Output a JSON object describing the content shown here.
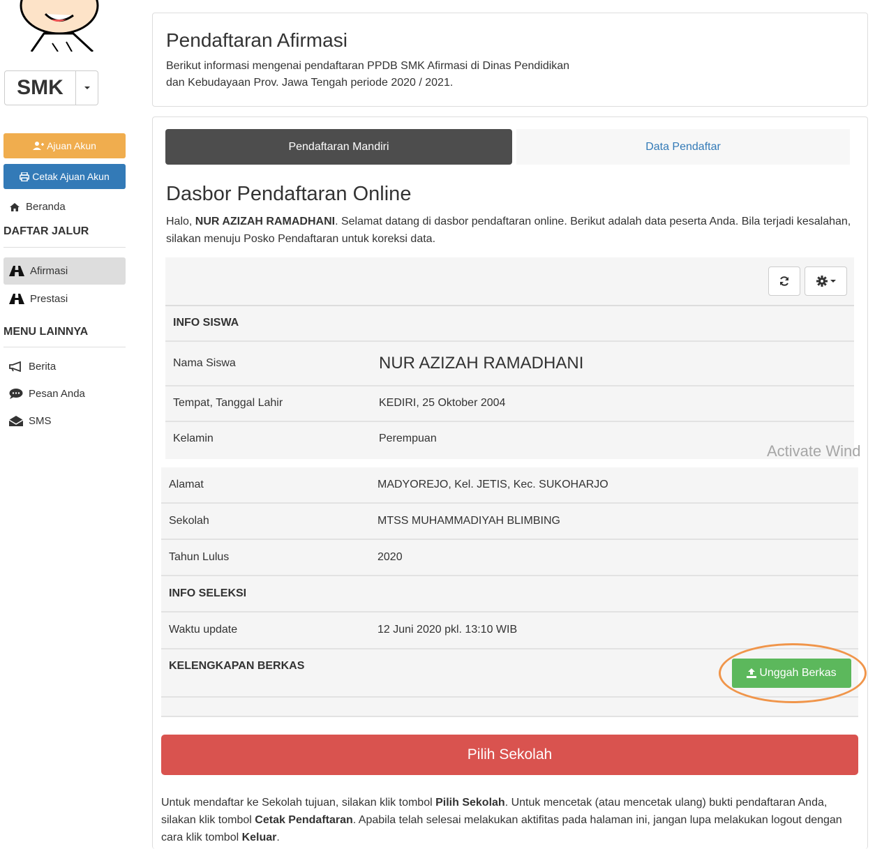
{
  "sidebar": {
    "smk_label": "SMK",
    "ajuan_akun": "Ajuan Akun",
    "cetak_ajuan_akun": "Cetak Ajuan Akun",
    "beranda": "Beranda",
    "daftar_jalur_heading": "DAFTAR JALUR",
    "afirmasi": "Afirmasi",
    "prestasi": "Prestasi",
    "menu_lainnya_heading": "MENU LAINNYA",
    "berita": "Berita",
    "pesan_anda": "Pesan Anda",
    "sms": "SMS"
  },
  "header": {
    "title": "Pendaftaran Afirmasi",
    "subtitle_line1": "Berikut informasi mengenai pendaftaran PPDB SMK Afirmasi di Dinas Pendidikan",
    "subtitle_line2": "dan Kebudayaan Prov. Jawa Tengah periode 2020 / 2021."
  },
  "tabs": {
    "mandiri": "Pendaftaran Mandiri",
    "data_pendaftar": "Data Pendaftar"
  },
  "dashboard": {
    "title": "Dasbor Pendaftaran Online",
    "intro_prefix": "Halo, ",
    "intro_name": "NUR AZIZAH RAMADHANI",
    "intro_rest": ". Selamat datang di dasbor pendaftaran online. Berikut adalah data peserta Anda. Bila terjadi kesalahan, silakan menuju Posko Pendaftaran untuk koreksi data."
  },
  "info_siswa": {
    "heading": "INFO SISWA",
    "rows": [
      {
        "label": "Nama Siswa",
        "value": "NUR AZIZAH RAMADHANI"
      },
      {
        "label": "Tempat, Tanggal Lahir",
        "value": "KEDIRI, 25 Oktober 2004"
      },
      {
        "label": "Kelamin",
        "value": "Perempuan"
      },
      {
        "label": "Alamat",
        "value": "MADYOREJO, Kel. JETIS, Kec. SUKOHARJO"
      },
      {
        "label": "Sekolah",
        "value": "MTSS MUHAMMADIYAH BLIMBING"
      },
      {
        "label": "Tahun Lulus",
        "value": "2020"
      }
    ]
  },
  "info_seleksi": {
    "heading": "INFO SELEKSI",
    "rows": [
      {
        "label": "Waktu update",
        "value": "12 Juni 2020 pkl. 13:10 WIB"
      }
    ]
  },
  "kelengkapan": {
    "heading": "KELENGKAPAN BERKAS",
    "upload_button": "Unggah Berkas"
  },
  "watermark": "Activate Wind",
  "pilih_sekolah": "Pilih Sekolah",
  "footer": {
    "p1": "Untuk mendaftar ke Sekolah tujuan, silakan klik tombol ",
    "b1": "Pilih Sekolah",
    "p2": ". Untuk mencetak (atau mencetak ulang) bukti pendaftaran Anda, silakan klik tombol ",
    "b2": "Cetak Pendaftaran",
    "p3": ". Apabila telah selesai melakukan aktifitas pada halaman ini, jangan lupa melakukan logout dengan cara klik tombol ",
    "b3": "Keluar",
    "p4": "."
  },
  "colors": {
    "warning": "#f0ad4e",
    "primary": "#337ab7",
    "success": "#5cb85c",
    "danger": "#d9534f",
    "highlight": "#f0954a"
  },
  "icons": [
    "user-plus-icon",
    "print-icon",
    "home-icon",
    "road-icon",
    "megaphone-icon",
    "comment-icon",
    "envelope-icon",
    "refresh-icon",
    "gear-icon",
    "upload-icon",
    "chevron-down-icon"
  ]
}
